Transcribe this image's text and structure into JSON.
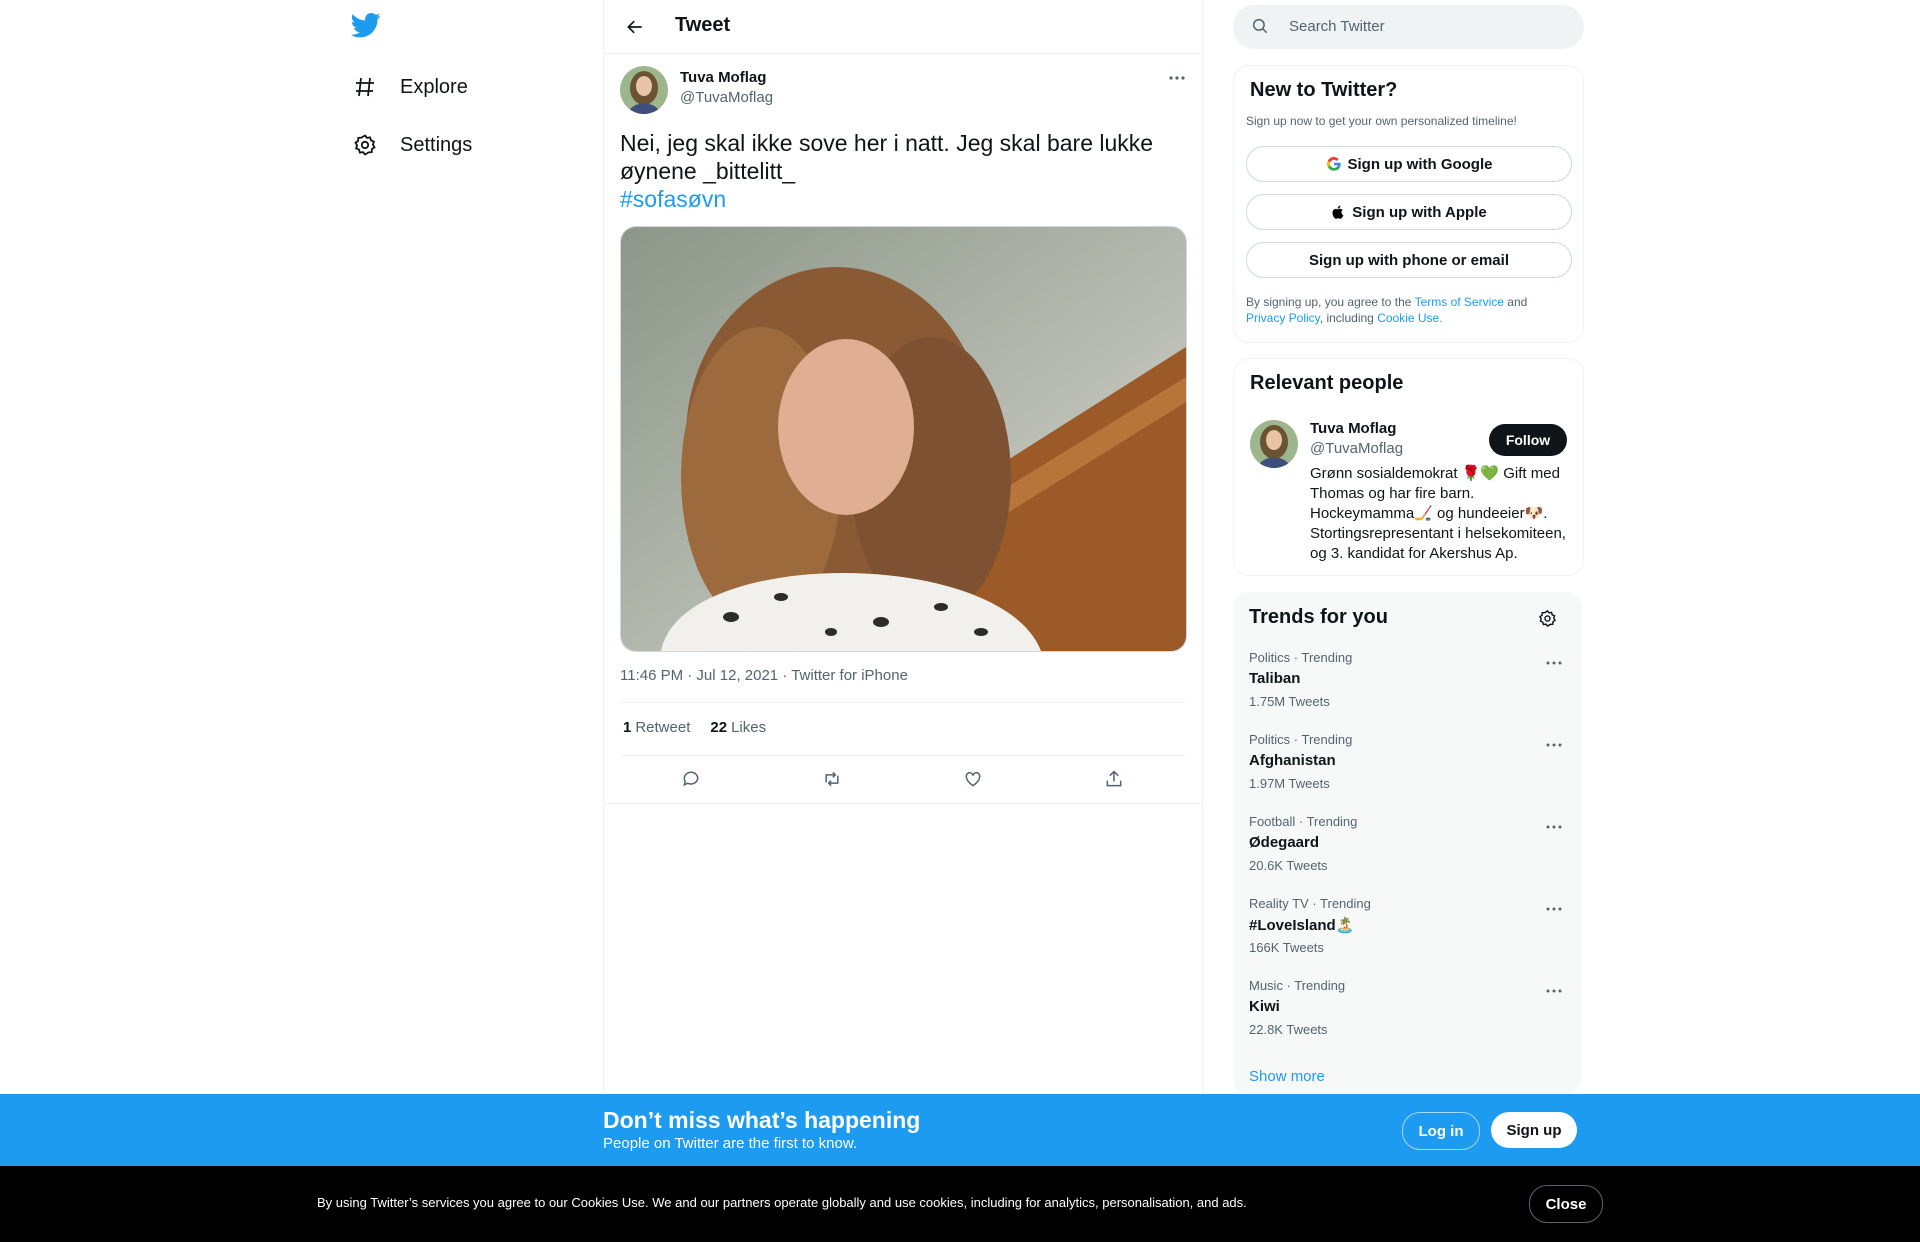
{
  "nav": {
    "items": [
      {
        "label": "Explore",
        "icon": "hashtag-icon"
      },
      {
        "label": "Settings",
        "icon": "gear-icon"
      }
    ]
  },
  "header": {
    "title": "Tweet"
  },
  "tweet": {
    "author_name": "Tuva Moflag",
    "author_handle": "@TuvaMoflag",
    "text": "Nei, jeg skal ikke sove her i natt. Jeg skal bare lukke øynene _bittelitt_",
    "hashtag": "#sofasøvn",
    "meta": "11:46 PM · Jul 12, 2021 · Twitter for iPhone",
    "retweets_count": "1",
    "retweets_label": "Retweet",
    "likes_count": "22",
    "likes_label": "Likes"
  },
  "search": {
    "placeholder": "Search Twitter"
  },
  "signup_card": {
    "title": "New to Twitter?",
    "subtitle": "Sign up now to get your own personalized timeline!",
    "google": "Sign up with Google",
    "apple": "Sign up with Apple",
    "email": "Sign up with phone or email",
    "legal_prefix": "By signing up, you agree to the",
    "terms": "Terms of Service",
    "and": "and",
    "privacy": "Privacy Policy",
    "including": ", including",
    "cookie": "Cookie Use."
  },
  "relevant": {
    "title": "Relevant people",
    "name": "Tuva Moflag",
    "handle": "@TuvaMoflag",
    "follow": "Follow",
    "bio": "Grønn sosialdemokrat 🌹💚 Gift med Thomas og har fire barn. Hockeymamma🏒 og hundeeier🐶. Stortingsrepresentant i helsekomiteen, og 3. kandidat for Akershus Ap."
  },
  "trends": {
    "title": "Trends for you",
    "items": [
      {
        "category": "Politics · Trending",
        "name": "Taliban",
        "count": "1.75M Tweets"
      },
      {
        "category": "Politics · Trending",
        "name": "Afghanistan",
        "count": "1.97M Tweets"
      },
      {
        "category": "Football · Trending",
        "name": "Ødegaard",
        "count": "20.6K Tweets"
      },
      {
        "category": "Reality TV · Trending",
        "name": "#LoveIsland🏝️",
        "count": "166K Tweets"
      },
      {
        "category": "Music · Trending",
        "name": "Kiwi",
        "count": "22.8K Tweets"
      }
    ],
    "show_more": "Show more"
  },
  "promo": {
    "title": "Don’t miss what’s happening",
    "subtitle": "People on Twitter are the first to know.",
    "login": "Log in",
    "signup": "Sign up"
  },
  "cookie": {
    "text": "By using Twitter’s services you agree to our Cookies Use. We and our partners operate globally and use cookies, including for analytics, personalisation, and ads.",
    "close": "Close"
  },
  "colors": {
    "accent": "#1d9bf0",
    "text": "#0f1419",
    "muted": "#536471"
  }
}
